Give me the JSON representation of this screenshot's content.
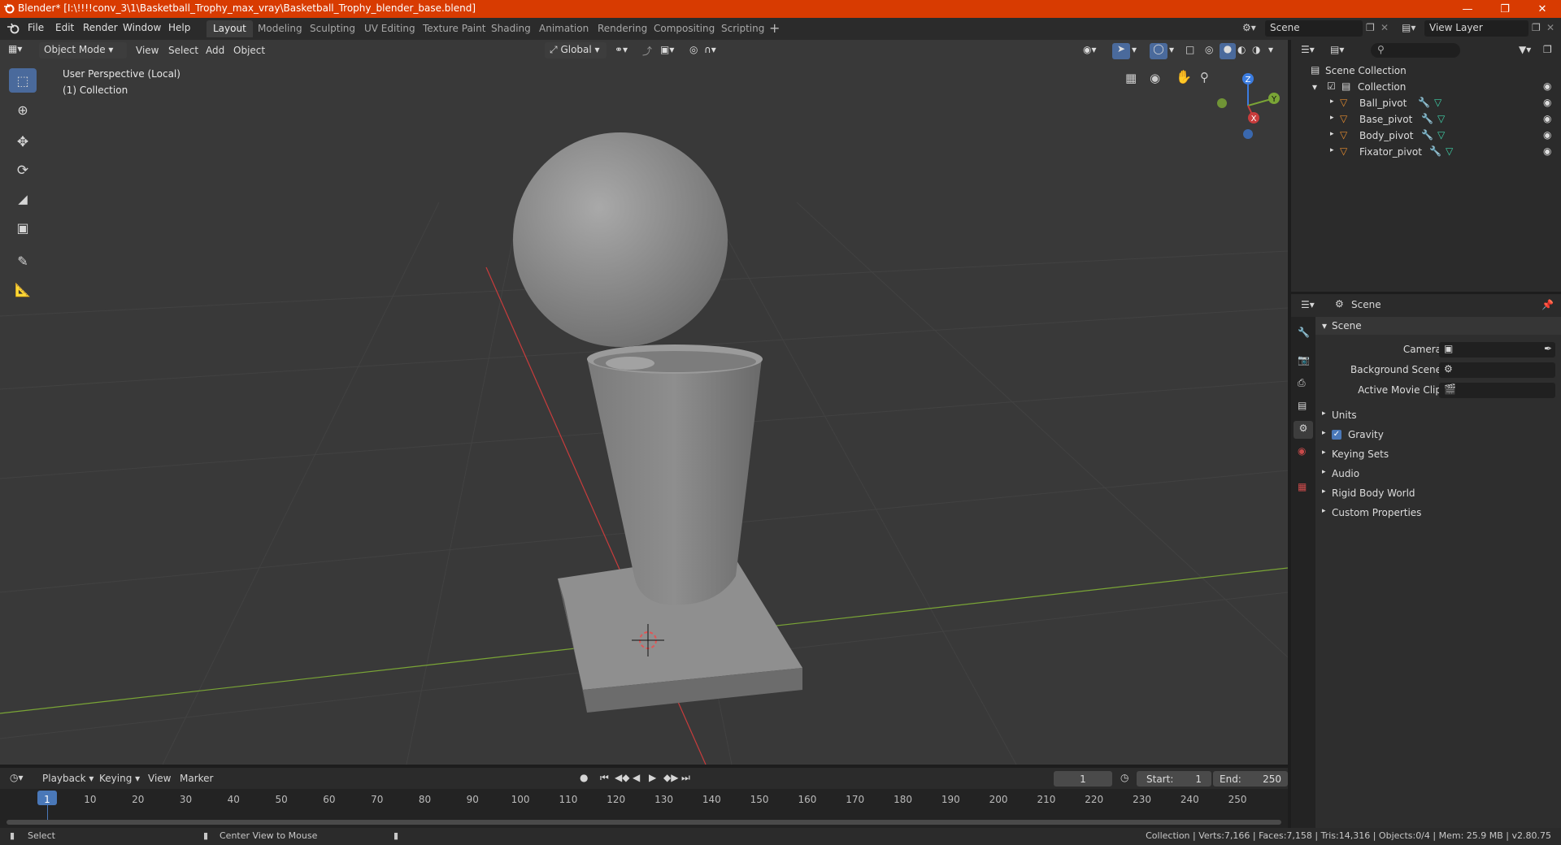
{
  "window": {
    "title": "Blender* [I:\\!!!!conv_3\\1\\Basketball_Trophy_max_vray\\Basketball_Trophy_blender_base.blend]",
    "controls": [
      "minimize-icon",
      "maximize-icon",
      "close-icon"
    ]
  },
  "menu": {
    "items": [
      "File",
      "Edit",
      "Render",
      "Window",
      "Help"
    ],
    "workspaces": [
      "Layout",
      "Modeling",
      "Sculpting",
      "UV Editing",
      "Texture Paint",
      "Shading",
      "Animation",
      "Rendering",
      "Compositing",
      "Scripting"
    ],
    "active_workspace": "Layout",
    "scene_name": "Scene",
    "view_layer": "View Layer"
  },
  "viewport_header": {
    "mode": "Object Mode",
    "menus": [
      "View",
      "Select",
      "Add",
      "Object"
    ],
    "transform_orientation": "Global"
  },
  "viewport": {
    "perspective": "User Perspective (Local)",
    "collection": "(1) Collection",
    "gizmo_axes": [
      "Z",
      "Y",
      "X"
    ]
  },
  "outliner": {
    "root": "Scene Collection",
    "collection": "Collection",
    "objects": [
      "Ball_pivot",
      "Base_pivot",
      "Body_pivot",
      "Fixator_pivot"
    ]
  },
  "properties": {
    "context": "Scene",
    "panel_title": "Scene",
    "fields": [
      {
        "label": "Camera",
        "value": ""
      },
      {
        "label": "Background Scene",
        "value": ""
      },
      {
        "label": "Active Movie Clip",
        "value": ""
      }
    ],
    "sections": [
      "Units",
      "Gravity",
      "Keying Sets",
      "Audio",
      "Rigid Body World",
      "Custom Properties"
    ],
    "gravity_checked": true
  },
  "timeline": {
    "menus": [
      "Playback",
      "Keying",
      "View",
      "Marker"
    ],
    "current_frame": "1",
    "start_label": "Start:",
    "start": "1",
    "end_label": "End:",
    "end": "250",
    "ticks": [
      "1",
      "10",
      "20",
      "30",
      "40",
      "50",
      "60",
      "70",
      "80",
      "90",
      "100",
      "110",
      "120",
      "130",
      "140",
      "150",
      "160",
      "170",
      "180",
      "190",
      "200",
      "210",
      "220",
      "230",
      "240",
      "250"
    ]
  },
  "statusbar": {
    "left": "Select",
    "middle": "Center View to Mouse",
    "right": "Collection | Verts:7,166 | Faces:7,158 | Tris:14,316 | Objects:0/4 | Mem: 25.9 MB | v2.80.75"
  },
  "colors": {
    "titlebar": "#d83b01",
    "accent": "#4a6a9c",
    "x_axis": "#c83c3c",
    "y_axis": "#7aa536",
    "z_axis": "#3b7ce0"
  }
}
